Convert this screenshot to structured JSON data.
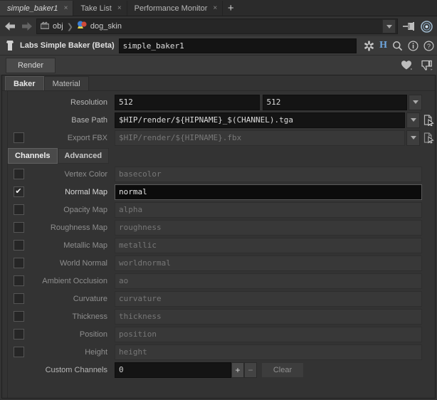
{
  "window": {
    "pane_tabs": [
      {
        "label": "simple_baker1",
        "active": true,
        "close": "×"
      },
      {
        "label": "Take List",
        "active": false,
        "close": "×"
      },
      {
        "label": "Performance Monitor",
        "active": false,
        "close": "×"
      }
    ],
    "new_tab": "+"
  },
  "pathbar": {
    "back_icon": "back-arrow-icon",
    "forward_icon": "forward-arrow-icon",
    "crumbs": [
      {
        "label": "obj",
        "icon": "network-obj-icon"
      },
      {
        "label": "dog_skin",
        "icon": "geometry-node-icon"
      }
    ],
    "separator": "❯",
    "dropdown_icon": "chevron-down-icon",
    "pin_icon": "pin-network-icon",
    "target_icon": "target-node-icon"
  },
  "param_header": {
    "op_icon": "labs-baker-icon",
    "op_label": "Labs Simple Baker (Beta)",
    "node_name": "simple_baker1",
    "icons": [
      {
        "name": "gear-icon",
        "glyph": "⚙"
      },
      {
        "name": "houdini-h-icon",
        "glyph": "H"
      },
      {
        "name": "search-icon",
        "glyph": "⌕"
      },
      {
        "name": "info-icon",
        "glyph": "ⓘ"
      },
      {
        "name": "help-icon",
        "glyph": "?"
      }
    ]
  },
  "render_toolbar": {
    "render_label": "Render",
    "favorite_icon": "heart-icon",
    "dislike_icon": "thumb-down-icon"
  },
  "main_tabs": [
    {
      "label": "Baker",
      "active": true
    },
    {
      "label": "Material",
      "active": false
    }
  ],
  "params": {
    "resolution": {
      "label": "Resolution",
      "x": "512",
      "y": "512",
      "menu_icon": "chevron-down-icon"
    },
    "base_path": {
      "label": "Base Path",
      "value": "$HIP/render/${HIPNAME}_$(CHANNEL).tga",
      "menu_icon": "chevron-down-icon",
      "browse_icon": "file-browse-icon"
    },
    "export_fbx": {
      "label": "Export FBX",
      "checked": false,
      "value": "$HIP/render/${HIPNAME}.fbx",
      "disabled": true,
      "menu_icon": "chevron-down-icon",
      "browse_icon": "file-browse-icon"
    }
  },
  "sub_tabs": [
    {
      "label": "Channels",
      "active": true
    },
    {
      "label": "Advanced",
      "active": false
    }
  ],
  "channels": [
    {
      "label": "Vertex Color",
      "value": "basecolor",
      "checked": false
    },
    {
      "label": "Normal Map",
      "value": "normal",
      "checked": true
    },
    {
      "label": "Opacity Map",
      "value": "alpha",
      "checked": false
    },
    {
      "label": "Roughness Map",
      "value": "roughness",
      "checked": false
    },
    {
      "label": "Metallic Map",
      "value": "metallic",
      "checked": false
    },
    {
      "label": "World Normal",
      "value": "worldnormal",
      "checked": false
    },
    {
      "label": "Ambient Occlusion",
      "value": "ao",
      "checked": false
    },
    {
      "label": "Curvature",
      "value": "curvature",
      "checked": false
    },
    {
      "label": "Thickness",
      "value": "thickness",
      "checked": false
    },
    {
      "label": "Position",
      "value": "position",
      "checked": false
    },
    {
      "label": "Height",
      "value": "height",
      "checked": false
    }
  ],
  "custom_channels": {
    "label": "Custom Channels",
    "value": "0",
    "add_label": "+",
    "remove_label": "−",
    "clear_label": "Clear"
  },
  "checkmark": "✔"
}
